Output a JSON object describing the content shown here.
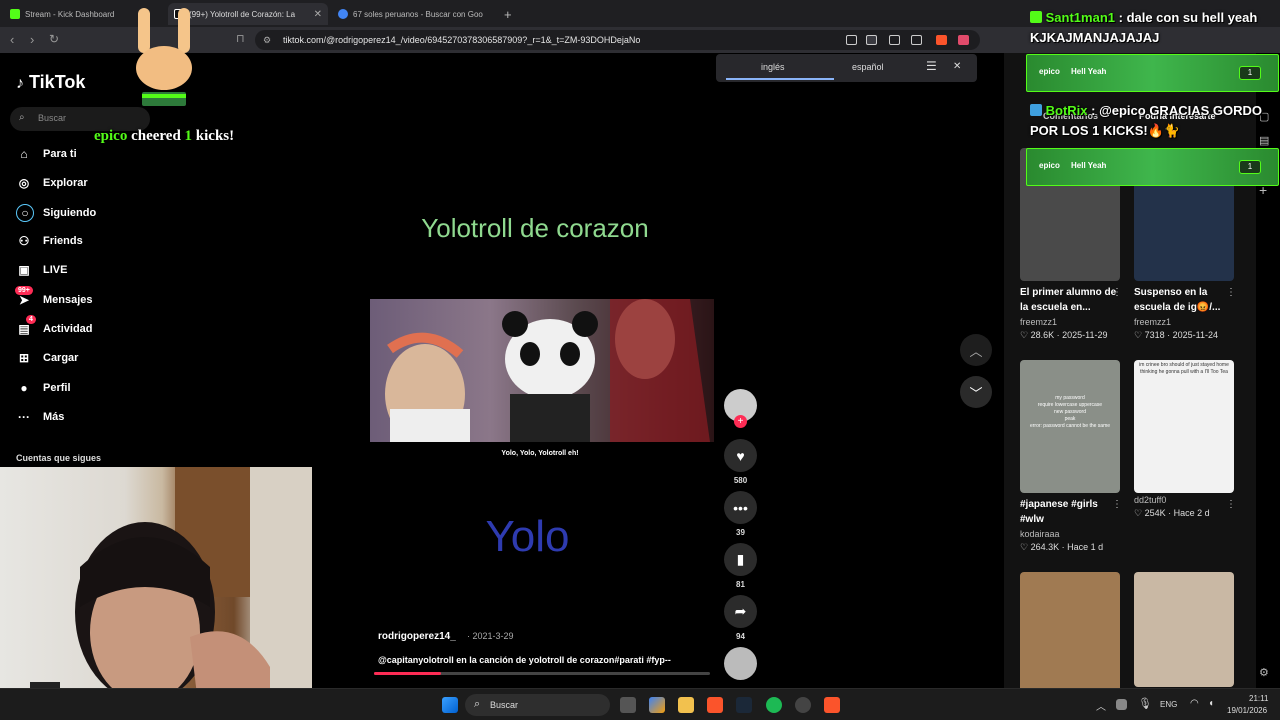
{
  "browser": {
    "tabs": [
      {
        "title": "Stream - Kick Dashboard",
        "color": "#53fc18"
      },
      {
        "title": "(99+) Yolotroll de Corazón: La",
        "color": "#ffffff"
      },
      {
        "title": "67 soles peruanos - Buscar con Goo",
        "color": "#4285f4"
      }
    ],
    "new_tab": "+",
    "url": "tiktok.com/@rodrigoperez14_/video/6945270378306587909?_r=1&_t=ZM-93DOHDejaNo"
  },
  "translate": {
    "lang_from": "inglés",
    "lang_to": "español"
  },
  "sidebar": {
    "logo": "TikTok",
    "search_placeholder": "Buscar",
    "items": [
      {
        "label": "Para ti",
        "icon": "home-icon",
        "glyph": "⌂"
      },
      {
        "label": "Explorar",
        "icon": "compass-icon",
        "glyph": "◎"
      },
      {
        "label": "Siguiendo",
        "icon": "following-icon",
        "glyph": "○"
      },
      {
        "label": "Friends",
        "icon": "friends-icon",
        "glyph": "⚇"
      },
      {
        "label": "LIVE",
        "icon": "live-icon",
        "glyph": "▣"
      },
      {
        "label": "Mensajes",
        "icon": "messages-icon",
        "glyph": "➤",
        "badge": "99+"
      },
      {
        "label": "Actividad",
        "icon": "activity-icon",
        "glyph": "▤",
        "badge": "4"
      },
      {
        "label": "Cargar",
        "icon": "upload-icon",
        "glyph": "⊞"
      },
      {
        "label": "Perfil",
        "icon": "profile-icon",
        "glyph": "●"
      },
      {
        "label": "Más",
        "icon": "more-icon",
        "glyph": "···"
      }
    ],
    "following_title": "Cuentas que sigues"
  },
  "video": {
    "title_text": "Yolotroll de corazon",
    "subtitle": "Yolo, Yolo, Yolotroll eh!",
    "big_text": "Yolo",
    "author": "rodrigoperez14_",
    "date": "· 2021-3-29",
    "caption": "@capitanyolotroll en la canción de yolotroll de corazon#parati #fyp--",
    "progress": 0.2
  },
  "actions": {
    "likes": "580",
    "comments": "39",
    "saves": "81",
    "shares": "94"
  },
  "right_panel": {
    "tabs": [
      "Comentarios",
      "Podría interesarte"
    ],
    "cards": [
      {
        "title": "El primer alumno de la escuela en...",
        "user": "freemzz1",
        "likes": "28.6K",
        "date": "2025-11-29",
        "color": "#4a4a4a"
      },
      {
        "title": "Suspenso en la escuela de ig😡/...",
        "user": "freemzz1",
        "likes": "7318",
        "date": "2025-11-24",
        "color": "#23324a"
      },
      {
        "title": "#japanese #girls #wlw",
        "user": "kodairaaa",
        "likes": "264.3K",
        "date": "Hace 1 d",
        "color": "#8a8f88"
      },
      {
        "title": "",
        "user": "dd2tuff0",
        "likes": "254K",
        "date": "Hace 2 d",
        "color": "#f2f2f2"
      },
      {
        "title": "",
        "user": "",
        "likes": "",
        "date": "",
        "color": "#a07a52"
      },
      {
        "title": "",
        "user": "",
        "likes": "",
        "date": "",
        "color": "#c9b8a4"
      }
    ],
    "thumb_texts": {
      "c3": "my password\nrequire lowercase uppercase\nnew password\npeak\nerror: password cannot be the same",
      "c4": "im crinee bro should of just stayed home thinking he gonna pull with a I'll Too Tea"
    }
  },
  "overlays": {
    "cheer": {
      "user": "epico",
      "mid": " cheered ",
      "amount": "1",
      "end": " kicks!"
    },
    "chat1": {
      "user": "Sant1man1",
      "sep": " : ",
      "msg": "dale con su hell yeah KJKAJMANJAJAJAJ"
    },
    "chat2": {
      "user": "BotRix",
      "sep": " : ",
      "msg": "@epico GRACIAS GORDO POR LOS 1 KICKS!🔥🐈"
    },
    "kick1": {
      "user": "epico",
      "text": "Hell Yeah",
      "count": "1"
    },
    "kick2": {
      "user": "epico",
      "text": "Hell Yeah",
      "count": "1"
    },
    "kick_colors": {
      "accent": "#53fc18"
    }
  },
  "taskbar": {
    "search": "Buscar",
    "lang": "ENG",
    "time": "21:11",
    "date": "19/01/2026"
  }
}
